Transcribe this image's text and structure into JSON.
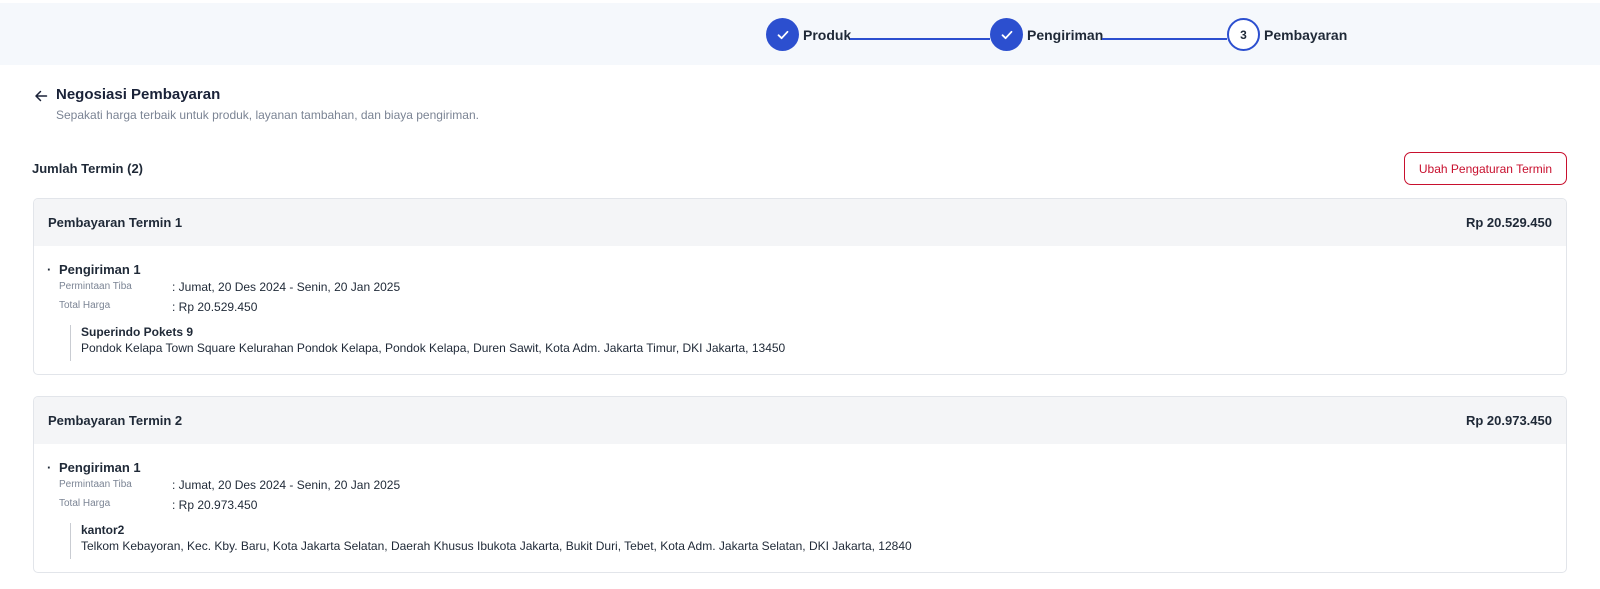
{
  "stepper": {
    "steps": [
      {
        "label": "Produk",
        "state": "done"
      },
      {
        "label": "Pengiriman",
        "state": "done"
      },
      {
        "label": "Pembayaran",
        "state": "active",
        "number": "3"
      }
    ],
    "accent_color": "#2c4fcf"
  },
  "header": {
    "title": "Negosiasi Pembayaran",
    "subtitle": "Sepakati harga terbaik untuk produk, layanan tambahan, dan biaya pengiriman."
  },
  "terms": {
    "count_label": "Jumlah Termin (2)",
    "change_button_label": "Ubah Pengaturan Termin",
    "button_color": "#c8102e",
    "items": [
      {
        "title": "Pembayaran Termin 1",
        "amount": "Rp 20.529.450",
        "shipment_title": "Pengiriman 1",
        "arrival_label": "Permintaan Tiba",
        "arrival_value": ": Jumat, 20 Des 2024 - Senin, 20 Jan 2025",
        "total_label": "Total Harga",
        "total_value": ": Rp 20.529.450",
        "address_name": "Superindo Pokets 9",
        "address_line": "Pondok Kelapa Town Square Kelurahan Pondok Kelapa, Pondok Kelapa, Duren Sawit, Kota Adm. Jakarta Timur, DKI Jakarta, 13450"
      },
      {
        "title": "Pembayaran Termin 2",
        "amount": "Rp 20.973.450",
        "shipment_title": "Pengiriman 1",
        "arrival_label": "Permintaan Tiba",
        "arrival_value": ": Jumat, 20 Des 2024 - Senin, 20 Jan 2025",
        "total_label": "Total Harga",
        "total_value": ": Rp 20.973.450",
        "address_name": "kantor2",
        "address_line": "Telkom Kebayoran, Kec. Kby. Baru, Kota Jakarta Selatan, Daerah Khusus Ibukota Jakarta, Bukit Duri, Tebet, Kota Adm. Jakarta Selatan, DKI Jakarta, 12840"
      }
    ]
  }
}
